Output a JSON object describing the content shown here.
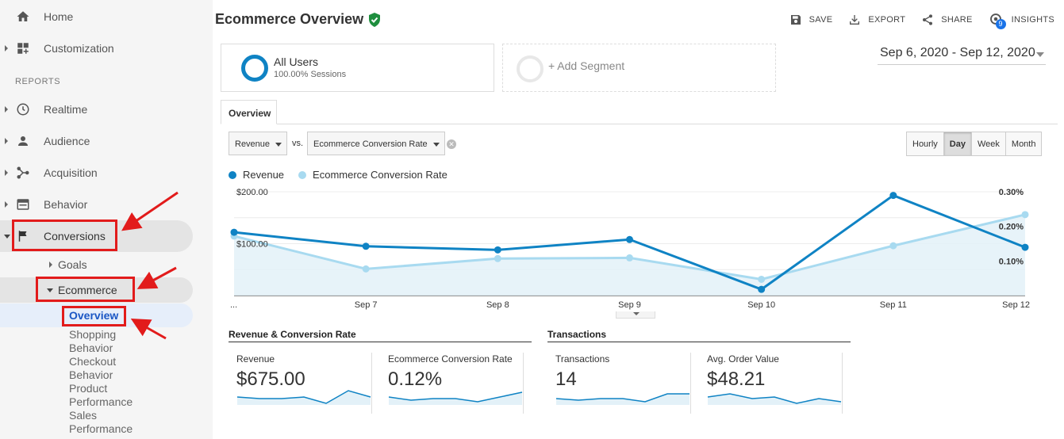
{
  "sidebar": {
    "top_items": [
      {
        "label": "Home",
        "icon": "home-icon"
      },
      {
        "label": "Customization",
        "icon": "dashboard-icon"
      }
    ],
    "reports_header": "REPORTS",
    "report_items": [
      {
        "label": "Realtime",
        "icon": "clock-icon"
      },
      {
        "label": "Audience",
        "icon": "person-icon"
      },
      {
        "label": "Acquisition",
        "icon": "acquisition-icon"
      },
      {
        "label": "Behavior",
        "icon": "behavior-icon"
      },
      {
        "label": "Conversions",
        "icon": "flag-icon"
      }
    ],
    "goals_label": "Goals",
    "ecommerce_label": "Ecommerce",
    "overview_label": "Overview",
    "ecommerce_subitems": [
      "Shopping",
      "Behavior",
      "Checkout",
      "Behavior",
      "Product",
      "Performance",
      "Sales",
      "Performance"
    ]
  },
  "header": {
    "title": "Ecommerce Overview",
    "verified_icon": "verified-shield-icon",
    "toolbar": [
      {
        "label": "SAVE",
        "icon": "save-icon"
      },
      {
        "label": "EXPORT",
        "icon": "export-icon"
      },
      {
        "label": "SHARE",
        "icon": "share-icon"
      },
      {
        "label": "INSIGHTS",
        "icon": "insights-icon",
        "badge": "9"
      }
    ]
  },
  "segments": {
    "active_name": "All Users",
    "active_sub": "100.00% Sessions",
    "add_label": "+ Add Segment"
  },
  "date_range": "Sep 6, 2020 - Sep 12, 2020",
  "tabs": [
    "Overview"
  ],
  "controls": {
    "metric1": "Revenue",
    "vs": "vs.",
    "metric2": "Ecommerce Conversion Rate",
    "granularity": [
      "Hourly",
      "Day",
      "Week",
      "Month"
    ],
    "granularity_active": "Day"
  },
  "colors": {
    "revenue": "#0f83c4",
    "conversion": "#a8daf0",
    "annotation": "#e21b1b"
  },
  "chart_data": {
    "type": "line",
    "x": [
      "Sep 6",
      "Sep 7",
      "Sep 8",
      "Sep 9",
      "Sep 10",
      "Sep 11",
      "Sep 12"
    ],
    "x_tick_labels": [
      "...",
      "Sep 7",
      "Sep 8",
      "Sep 9",
      "Sep 10",
      "Sep 11",
      "Sep 12"
    ],
    "series": [
      {
        "name": "Revenue",
        "axis": "left",
        "values": [
          122,
          95,
          88,
          108,
          12,
          193,
          93
        ]
      },
      {
        "name": "Ecommerce Conversion Rate",
        "axis": "right",
        "values": [
          0.172,
          0.077,
          0.107,
          0.109,
          0.047,
          0.144,
          0.234
        ]
      }
    ],
    "y_left": {
      "ticks": [
        "$200.00",
        "$100.00"
      ],
      "range": [
        0,
        200
      ]
    },
    "y_right": {
      "ticks": [
        "0.30%",
        "0.20%",
        "0.10%"
      ],
      "range": [
        0,
        0.3
      ]
    },
    "grid": true,
    "legend_position": "top-left"
  },
  "scorecards": {
    "group1_title": "Revenue & Conversion Rate",
    "group2_title": "Transactions",
    "cards": [
      {
        "label": "Revenue",
        "value": "$675.00",
        "spark": [
          5,
          4,
          4,
          5,
          1,
          9,
          5
        ]
      },
      {
        "label": "Ecommerce Conversion Rate",
        "value": "0.12%",
        "spark": [
          5,
          3,
          4,
          4,
          2,
          5,
          8
        ]
      },
      {
        "label": "Transactions",
        "value": "14",
        "spark": [
          4,
          3,
          4,
          4,
          2,
          7,
          7
        ]
      },
      {
        "label": "Avg. Order Value",
        "value": "$48.21",
        "spark": [
          5,
          7,
          4,
          5,
          1,
          4,
          2
        ]
      }
    ]
  }
}
